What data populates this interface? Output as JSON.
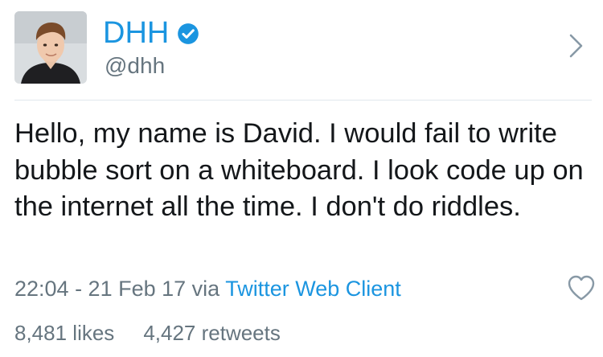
{
  "user": {
    "display_name": "DHH",
    "handle": "@dhh",
    "verified": true,
    "avatar_icon": "profile-photo"
  },
  "tweet": {
    "text": "Hello, my name is David. I would fail to write bubble sort on a whiteboard. I look code up on the internet all the time. I don't do riddles.",
    "timestamp": "22:04 - 21 Feb 17",
    "via_label": "via",
    "source": "Twitter Web Client"
  },
  "stats": {
    "likes": "8,481 likes",
    "retweets": "4,427 retweets"
  },
  "icons": {
    "verified": "verified-badge-icon",
    "chevron": "chevron-right-icon",
    "like": "heart-outline-icon"
  },
  "colors": {
    "accent": "#1b95e0",
    "secondary_text": "#66757f",
    "primary_text": "#14171a",
    "divider": "#e1e8ed"
  }
}
